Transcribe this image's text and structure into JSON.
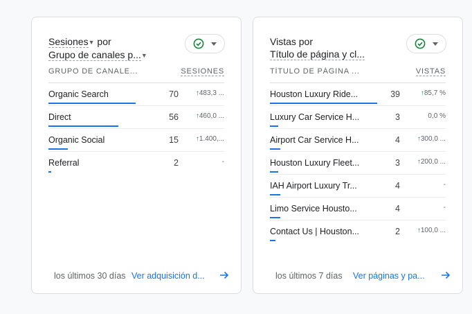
{
  "cards": [
    {
      "title_metric": "Sesiones",
      "title_by": " por",
      "title_dimension": "Grupo de canales p...",
      "col_dimension": "GRUPO DE CANALE...",
      "col_metric": "SESIONES",
      "rows": [
        {
          "label": "Organic Search",
          "value": "70",
          "change": "483,3 ...",
          "trend": "up",
          "share": 1.0
        },
        {
          "label": "Direct",
          "value": "56",
          "change": "460,0 ...",
          "trend": "up",
          "share": 0.8
        },
        {
          "label": "Organic Social",
          "value": "15",
          "change": "1.400,...",
          "trend": "up",
          "share": 0.22
        },
        {
          "label": "Referral",
          "value": "2",
          "change": "-",
          "trend": "none",
          "share": 0.03
        }
      ],
      "period": "los últimos 30 días",
      "link": "Ver adquisición d..."
    },
    {
      "title_metric": "Vistas",
      "title_by": " por",
      "title_dimension": "Título de página y cl...",
      "col_dimension": "TÍTULO DE PÁGINA ...",
      "col_metric": "VISTAS",
      "rows": [
        {
          "label": "Houston Luxury Ride...",
          "value": "39",
          "change": "85,7 %",
          "trend": "up",
          "share": 1.0
        },
        {
          "label": "Luxury Car Service H...",
          "value": "3",
          "change": "0,0 %",
          "trend": "none",
          "share": 0.08
        },
        {
          "label": "Airport Car Service H...",
          "value": "4",
          "change": "300,0 ...",
          "trend": "up",
          "share": 0.1
        },
        {
          "label": "Houston Luxury Fleet...",
          "value": "3",
          "change": "200,0 ...",
          "trend": "up",
          "share": 0.08
        },
        {
          "label": "IAH Airport Luxury Tr...",
          "value": "4",
          "change": "-",
          "trend": "none",
          "share": 0.1
        },
        {
          "label": "Limo Service Housto...",
          "value": "4",
          "change": "-",
          "trend": "none",
          "share": 0.1
        },
        {
          "label": "Contact Us | Houston...",
          "value": "2",
          "change": "100,0 ...",
          "trend": "up",
          "share": 0.05
        }
      ],
      "period": "los últimos 7 días",
      "link": "Ver páginas y pa..."
    }
  ],
  "colors": {
    "accent": "#1a73e8",
    "up": "#188038",
    "check": "#188038"
  }
}
